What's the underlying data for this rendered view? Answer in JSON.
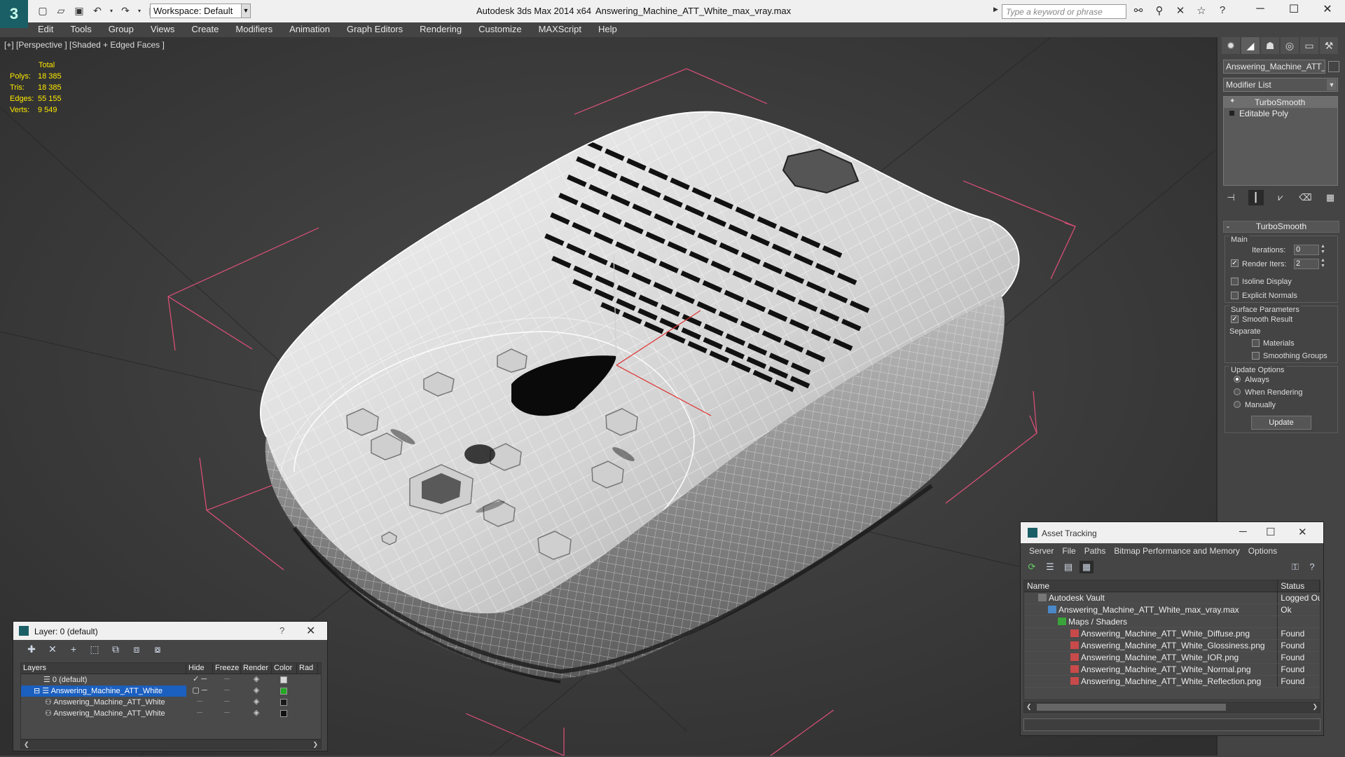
{
  "titlebar": {
    "app_title": "Autodesk 3ds Max  2014 x64",
    "file_title": "Answering_Machine_ATT_White_max_vray.max",
    "workspace": "Workspace: Default",
    "search_placeholder": "Type a keyword or phrase"
  },
  "menu": [
    "Edit",
    "Tools",
    "Group",
    "Views",
    "Create",
    "Modifiers",
    "Animation",
    "Graph Editors",
    "Rendering",
    "Customize",
    "MAXScript",
    "Help"
  ],
  "viewport": {
    "label": "[+] [Perspective ] [Shaded + Edged Faces ]",
    "stats": {
      "header": "Total",
      "polys_label": "Polys:",
      "polys": "18 385",
      "tris_label": "Tris:",
      "tris": "18 385",
      "edges_label": "Edges:",
      "edges": "55 155",
      "verts_label": "Verts:",
      "verts": "9 549"
    },
    "colors": {
      "stats": "#ffea00",
      "bbox": "#e0507a",
      "mesh": "#f2f2f2"
    }
  },
  "command_panel": {
    "object_name": "Answering_Machine_ATT_Wh",
    "modifier_list": "Modifier List",
    "stack": [
      "TurboSmooth",
      "Editable Poly"
    ],
    "rollout": {
      "title": "TurboSmooth",
      "main_title": "Main",
      "iterations_label": "Iterations:",
      "iterations": "0",
      "render_iters_label": "Render Iters:",
      "render_iters": "2",
      "isoline_label": "Isoline Display",
      "explicit_normals_label": "Explicit Normals",
      "surface_title": "Surface Parameters",
      "smooth_result_label": "Smooth Result",
      "separate_label": "Separate",
      "materials_label": "Materials",
      "smoothing_groups_label": "Smoothing Groups",
      "update_title": "Update Options",
      "always_label": "Always",
      "when_rendering_label": "When Rendering",
      "manually_label": "Manually",
      "update_button": "Update"
    }
  },
  "layer_window": {
    "title": "Layer: 0 (default)",
    "columns": [
      "Layers",
      "Hide",
      "Freeze",
      "Render",
      "Color",
      "Rad"
    ],
    "rows": [
      {
        "name": "0 (default)",
        "color": "#d8d8d8"
      },
      {
        "name": "Answering_Machine_ATT_White",
        "color": "#22aa22"
      },
      {
        "name": "Answering_Machine_ATT_White",
        "color": "#1a1a1a"
      },
      {
        "name": "Answering_Machine_ATT_White",
        "color": "#111111"
      }
    ]
  },
  "asset_window": {
    "title": "Asset Tracking",
    "menu": [
      "Server",
      "File",
      "Paths",
      "Bitmap Performance and Memory",
      "Options"
    ],
    "columns": [
      "Name",
      "Status"
    ],
    "rows": [
      {
        "name": "Autodesk Vault",
        "status": "Logged Ou"
      },
      {
        "name": "Answering_Machine_ATT_White_max_vray.max",
        "status": "Ok"
      },
      {
        "name": "Maps / Shaders",
        "status": ""
      },
      {
        "name": "Answering_Machine_ATT_White_Diffuse.png",
        "status": "Found"
      },
      {
        "name": "Answering_Machine_ATT_White_Glossiness.png",
        "status": "Found"
      },
      {
        "name": "Answering_Machine_ATT_White_IOR.png",
        "status": "Found"
      },
      {
        "name": "Answering_Machine_ATT_White_Normal.png",
        "status": "Found"
      },
      {
        "name": "Answering_Machine_ATT_White_Reflection.png",
        "status": "Found"
      }
    ]
  }
}
